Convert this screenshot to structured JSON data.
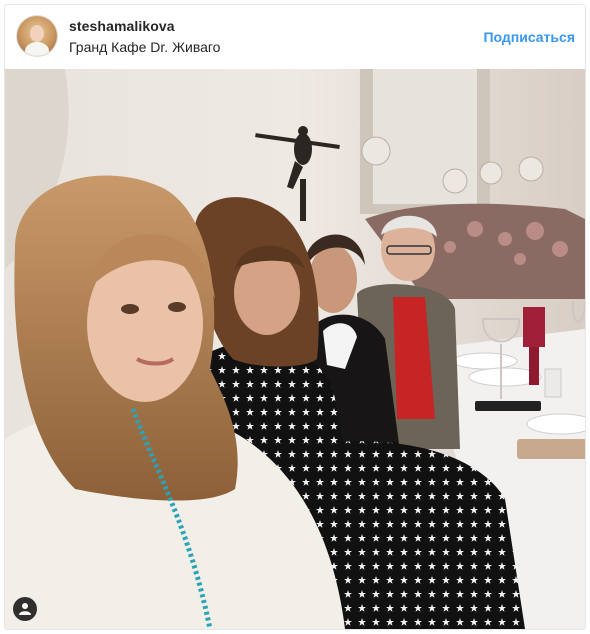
{
  "post": {
    "username": "steshamalikova",
    "location": "Гранд Кафе Dr. Живаго",
    "follow_label": "Подписаться"
  },
  "icons": {
    "tag": "person-tag-icon"
  },
  "colors": {
    "follow_blue": "#3897f0",
    "text_dark": "#262626"
  }
}
